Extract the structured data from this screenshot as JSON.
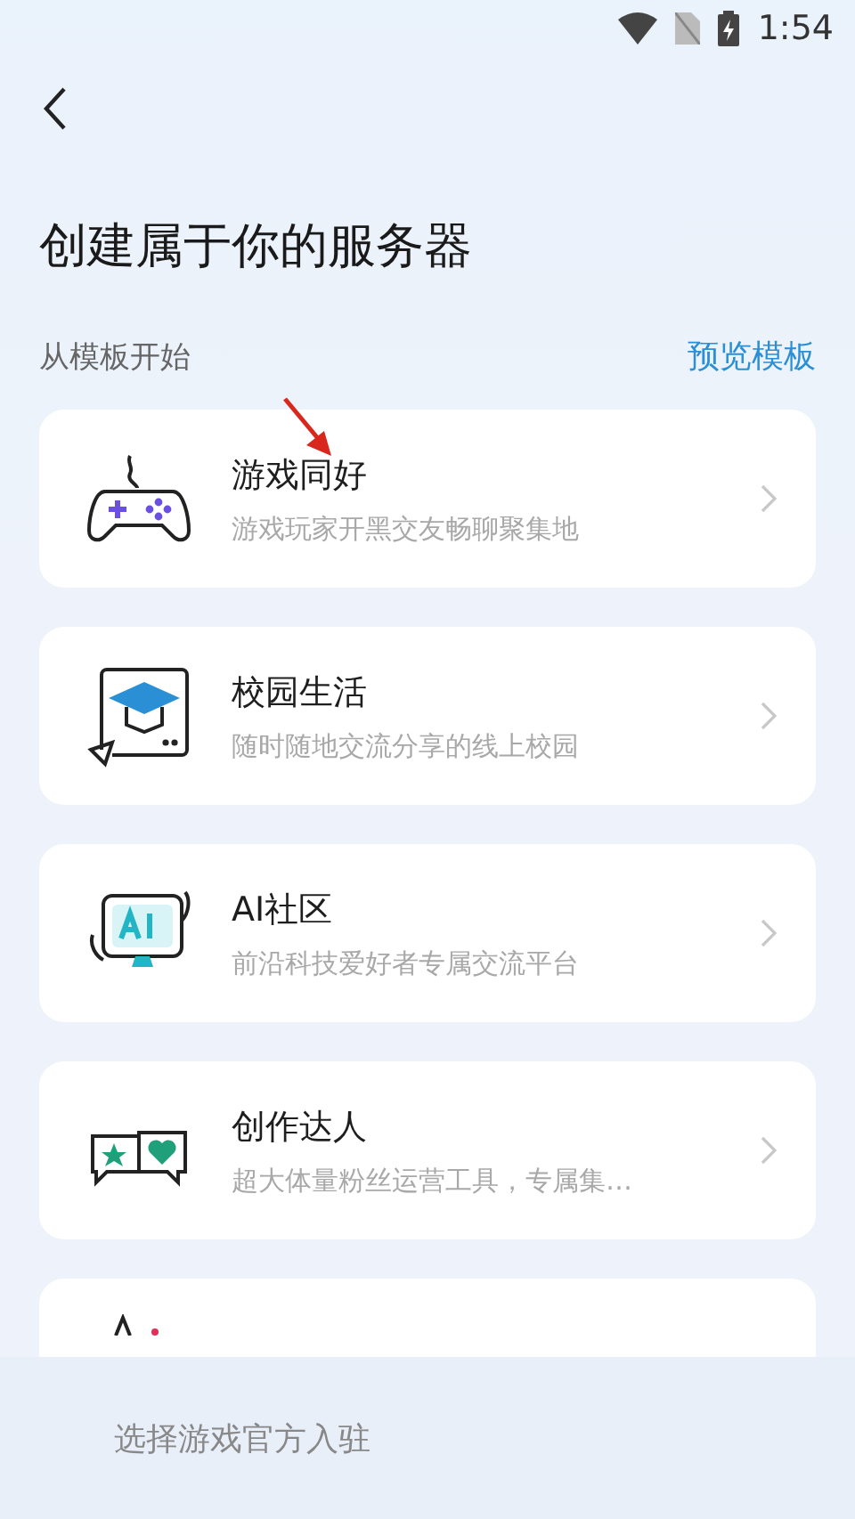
{
  "status_bar": {
    "time": "1:54"
  },
  "title": "创建属于你的服务器",
  "section": {
    "label": "从模板开始",
    "action": "预览模板"
  },
  "templates": [
    {
      "kind": "gamepad",
      "title": "游戏同好",
      "subtitle": "游戏玩家开黑交友畅聊聚集地"
    },
    {
      "kind": "campus",
      "title": "校园生活",
      "subtitle": "随时随地交流分享的线上校园"
    },
    {
      "kind": "ai",
      "title": "AI社区",
      "subtitle": "前沿科技爱好者专属交流平台"
    },
    {
      "kind": "creator",
      "title": "创作达人",
      "subtitle": "超大体量粉丝运营工具，专属集…"
    },
    {
      "kind": "partial"
    }
  ],
  "bottom_bar": {
    "text": "选择游戏官方入驻"
  }
}
